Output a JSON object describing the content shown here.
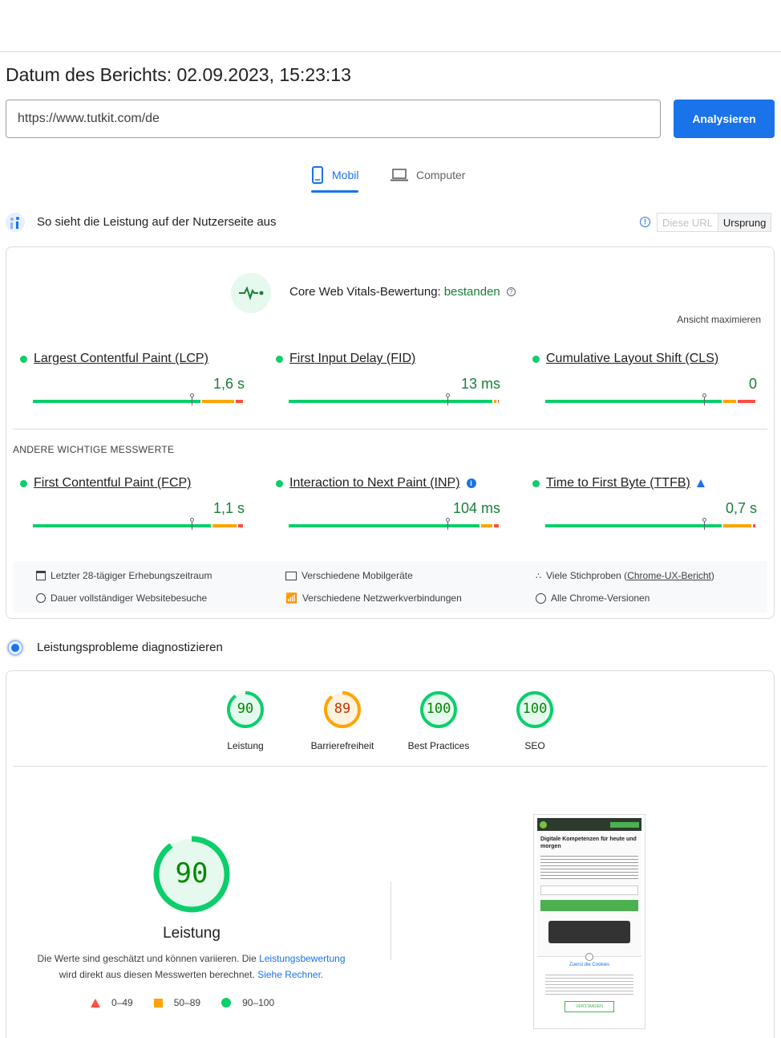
{
  "report": {
    "date_label": "Datum des Berichts: 02.09.2023, 15:23:13",
    "url_value": "https://www.tutkit.com/de",
    "analyze_label": "Analysieren"
  },
  "tabs": {
    "mobile": "Mobil",
    "desktop": "Computer",
    "active": "mobile"
  },
  "field_section": {
    "title": "So sieht die Leistung auf der Nutzerseite aus",
    "toggle_url": "Diese URL",
    "toggle_origin": "Ursprung",
    "cwv_label": "Core Web Vitals-Bewertung:",
    "cwv_status": "bestanden",
    "expand_label": "Ansicht maximieren",
    "other_metrics_title": "ANDERE WICHTIGE MESSWERTE",
    "core_metrics": [
      {
        "name": "Largest Contentful Paint (LCP)",
        "value": "1,6 s",
        "marker": 0.75,
        "good": 0.8,
        "ni": 0.16,
        "poor": 0.04
      },
      {
        "name": "First Input Delay (FID)",
        "value": "13 ms",
        "marker": 0.75,
        "good": 0.97,
        "ni": 0.02,
        "poor": 0.01
      },
      {
        "name": "Cumulative Layout Shift (CLS)",
        "value": "0",
        "marker": 0.75,
        "good": 0.84,
        "ni": 0.07,
        "poor": 0.09
      }
    ],
    "other_metrics": [
      {
        "name": "First Contentful Paint (FCP)",
        "value": "1,1 s",
        "marker": 0.75,
        "good": 0.85,
        "ni": 0.12,
        "poor": 0.03
      },
      {
        "name": "Interaction to Next Paint (INP)",
        "value": "104 ms",
        "marker": 0.75,
        "good": 0.91,
        "ni": 0.06,
        "poor": 0.03
      },
      {
        "name": "Time to First Byte (TTFB)",
        "value": "0,7 s",
        "marker": 0.75,
        "good": 0.84,
        "ni": 0.14,
        "poor": 0.02
      }
    ],
    "info": {
      "period": "Letzter 28-tägiger Erhebungszeitraum",
      "duration": "Dauer vollständiger Websitebesuche",
      "devices": "Verschiedene Mobilgeräte",
      "networks": "Verschiedene Netzwerkverbindungen",
      "samples_prefix": "Viele Stichproben (",
      "samples_link": "Chrome-UX-Bericht",
      "samples_suffix": ")",
      "versions": "Alle Chrome-Versionen"
    }
  },
  "lab_section": {
    "title": "Leistungsprobleme diagnostizieren",
    "scores": [
      {
        "label": "Leistung",
        "score": "90",
        "value": 0.9,
        "color": "#0cce6b",
        "text_color": "#008800",
        "bg": "#e6f9ee"
      },
      {
        "label": "Barrierefreiheit",
        "score": "89",
        "value": 0.89,
        "color": "#ffa400",
        "text_color": "#c33300",
        "bg": "#fff3e0"
      },
      {
        "label": "Best Practices",
        "score": "100",
        "value": 1.0,
        "color": "#0cce6b",
        "text_color": "#008800",
        "bg": "#e6f9ee"
      },
      {
        "label": "SEO",
        "score": "100",
        "value": 1.0,
        "color": "#0cce6b",
        "text_color": "#008800",
        "bg": "#e6f9ee"
      }
    ],
    "big_score": "90",
    "big_label": "Leistung",
    "big_value": 0.9,
    "desc_1": "Die Werte sind geschätzt und können variieren. Die ",
    "desc_link1": "Leistungsbewertung",
    "desc_2": "wird direkt aus diesen Messwerten berechnet. ",
    "desc_link2": "Siehe Rechner.",
    "legend": [
      "0–49",
      "50–89",
      "90–100"
    ]
  },
  "screenshot": {
    "headline": "Digitale Kompetenzen für heute und morgen",
    "cookie_title": "Zuerst die Cookies",
    "cookie_button": "VERSTANDEN"
  },
  "colors": {
    "good": "#0cce6b",
    "average": "#ffa400",
    "poor": "#ff4e42",
    "accent": "#1a73e8"
  }
}
